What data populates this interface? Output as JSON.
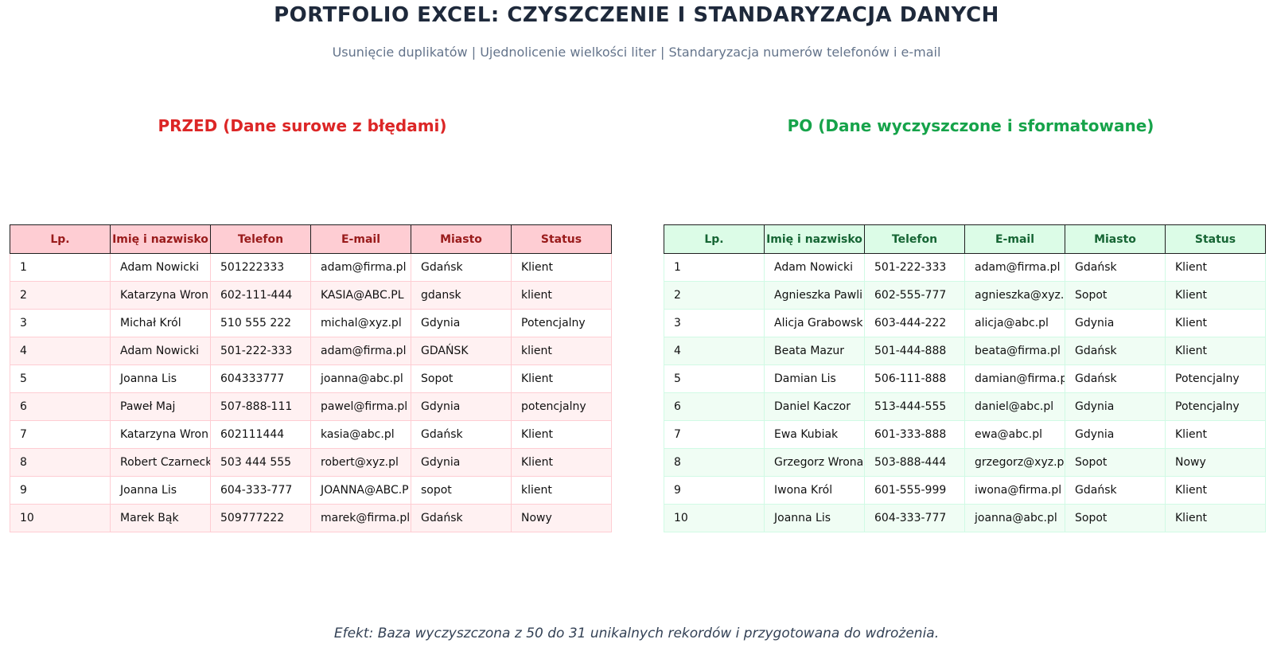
{
  "title": "PORTFOLIO EXCEL: CZYSZCZENIE I STANDARYZACJA DANYCH",
  "subtitle": "Usunięcie duplikatów | Ujednolicenie wielkości liter | Standaryzacja numerów telefonów i e-mail",
  "before": {
    "title": "PRZED (Dane surowe z błędami)",
    "headers": [
      "Lp.",
      "Imię i nazwisko",
      "Telefon",
      "E-mail",
      "Miasto",
      "Status"
    ],
    "rows": [
      [
        "1",
        "Adam Nowicki",
        "501222333",
        "adam@firma.pl",
        "Gdańsk",
        "Klient"
      ],
      [
        "2",
        "Katarzyna Wron",
        "602-111-444",
        "KASIA@ABC.PL",
        "gdansk",
        "klient"
      ],
      [
        "3",
        "Michał Król",
        "510 555 222",
        "michal@xyz.pl",
        "Gdynia",
        "Potencjalny"
      ],
      [
        "4",
        "Adam Nowicki",
        "501-222-333",
        "adam@firma.pl",
        "GDAŃSK",
        "klient"
      ],
      [
        "5",
        "Joanna Lis",
        "604333777",
        "joanna@abc.pl",
        "Sopot",
        "Klient"
      ],
      [
        "6",
        "Paweł Maj",
        "507-888-111",
        "pawel@firma.pl",
        "Gdynia",
        "potencjalny"
      ],
      [
        "7",
        "Katarzyna Wron",
        "602111444",
        "kasia@abc.pl",
        "Gdańsk",
        "Klient"
      ],
      [
        "8",
        "Robert Czarneck",
        "503 444 555",
        "robert@xyz.pl",
        "Gdynia",
        "Klient"
      ],
      [
        "9",
        "Joanna Lis",
        "604-333-777",
        "JOANNA@ABC.P",
        "sopot",
        "klient"
      ],
      [
        "10",
        "Marek Bąk",
        "509777222",
        "marek@firma.pl",
        "Gdańsk",
        "Nowy"
      ]
    ],
    "header_bg": "#fecdd3",
    "header_color": "#991b1b",
    "title_color": "#dc2626"
  },
  "after": {
    "title": "PO (Dane wyczyszczone i sformatowane)",
    "headers": [
      "Lp.",
      "Imię i nazwisko",
      "Telefon",
      "E-mail",
      "Miasto",
      "Status"
    ],
    "rows": [
      [
        "1",
        "Adam Nowicki",
        "501-222-333",
        "adam@firma.pl",
        "Gdańsk",
        "Klient"
      ],
      [
        "2",
        "Agnieszka Pawli",
        "602-555-777",
        "agnieszka@xyz.",
        "Sopot",
        "Klient"
      ],
      [
        "3",
        "Alicja Grabowsk",
        "603-444-222",
        "alicja@abc.pl",
        "Gdynia",
        "Klient"
      ],
      [
        "4",
        "Beata Mazur",
        "501-444-888",
        "beata@firma.pl",
        "Gdańsk",
        "Klient"
      ],
      [
        "5",
        "Damian Lis",
        "506-111-888",
        "damian@firma.p",
        "Gdańsk",
        "Potencjalny"
      ],
      [
        "6",
        "Daniel Kaczor",
        "513-444-555",
        "daniel@abc.pl",
        "Gdynia",
        "Potencjalny"
      ],
      [
        "7",
        "Ewa Kubiak",
        "601-333-888",
        "ewa@abc.pl",
        "Gdynia",
        "Klient"
      ],
      [
        "8",
        "Grzegorz Wrona",
        "503-888-444",
        "grzegorz@xyz.p",
        "Sopot",
        "Nowy"
      ],
      [
        "9",
        "Iwona Król",
        "601-555-999",
        "iwona@firma.pl",
        "Gdańsk",
        "Klient"
      ],
      [
        "10",
        "Joanna Lis",
        "604-333-777",
        "joanna@abc.pl",
        "Sopot",
        "Klient"
      ]
    ],
    "header_bg": "#dcfce7",
    "header_color": "#166534",
    "title_color": "#16a34a"
  },
  "footer": "Efekt: Baza wyczyszczona z 50 do 31 unikalnych rekordów i przygotowana do wdrożenia."
}
